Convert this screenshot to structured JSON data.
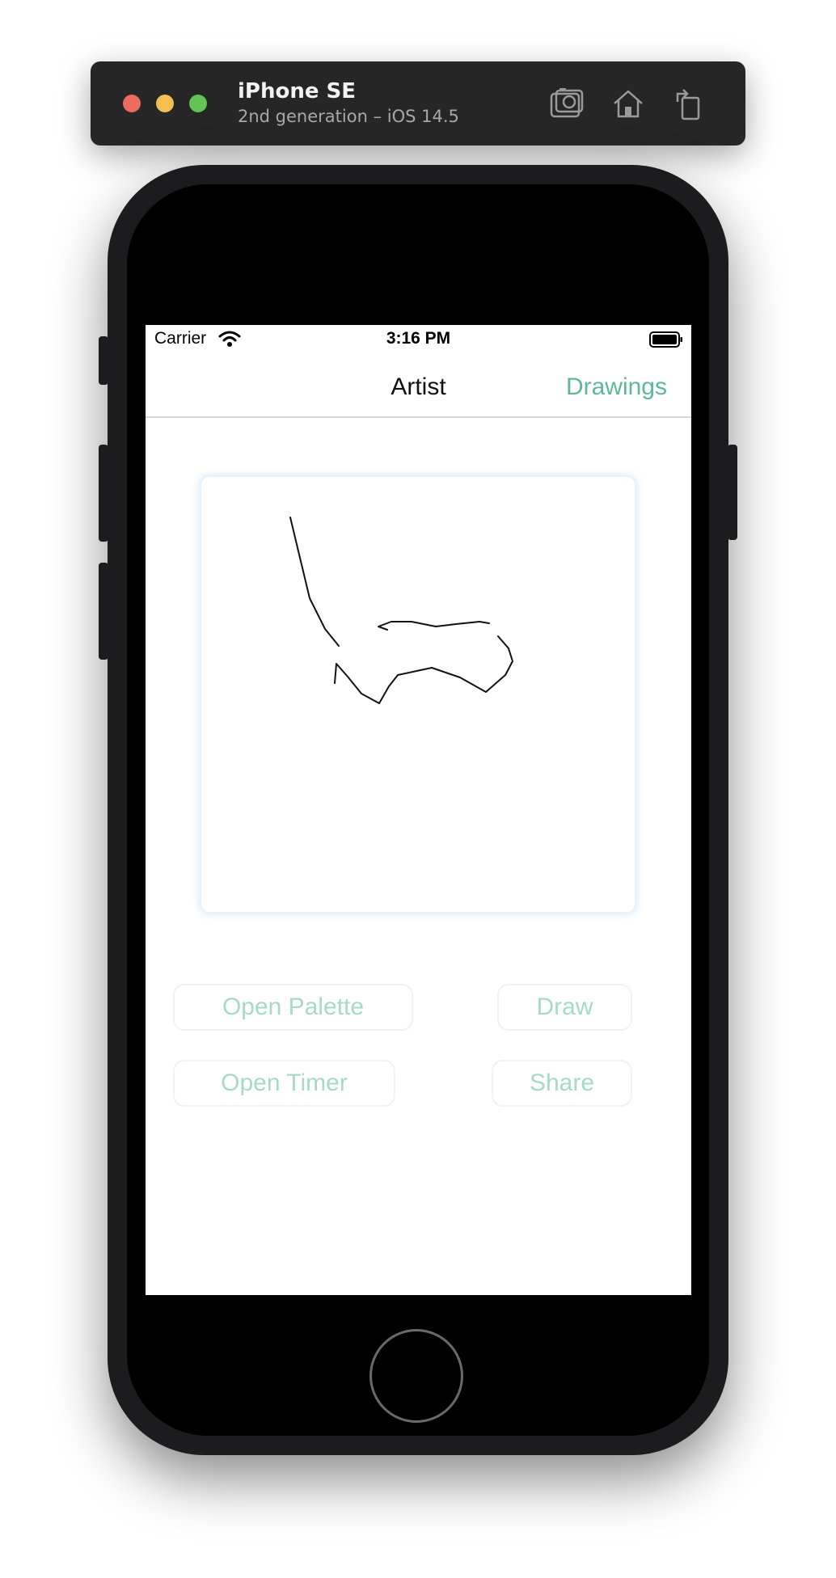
{
  "simulator": {
    "device_name": "iPhone SE",
    "device_detail": "2nd generation – iOS 14.5",
    "icons": [
      "screenshot-icon",
      "home-icon",
      "rotate-icon"
    ]
  },
  "status_bar": {
    "carrier": "Carrier",
    "time": "3:16 PM"
  },
  "nav": {
    "title": "Artist",
    "right_button": "Drawings"
  },
  "buttons": {
    "open_palette": "Open Palette",
    "draw": "Draw",
    "open_timer": "Open Timer",
    "share": "Share"
  },
  "colors": {
    "accent": "#5fb79b",
    "button_text": "#a7d9c8",
    "simulator_bar": "#262626"
  }
}
